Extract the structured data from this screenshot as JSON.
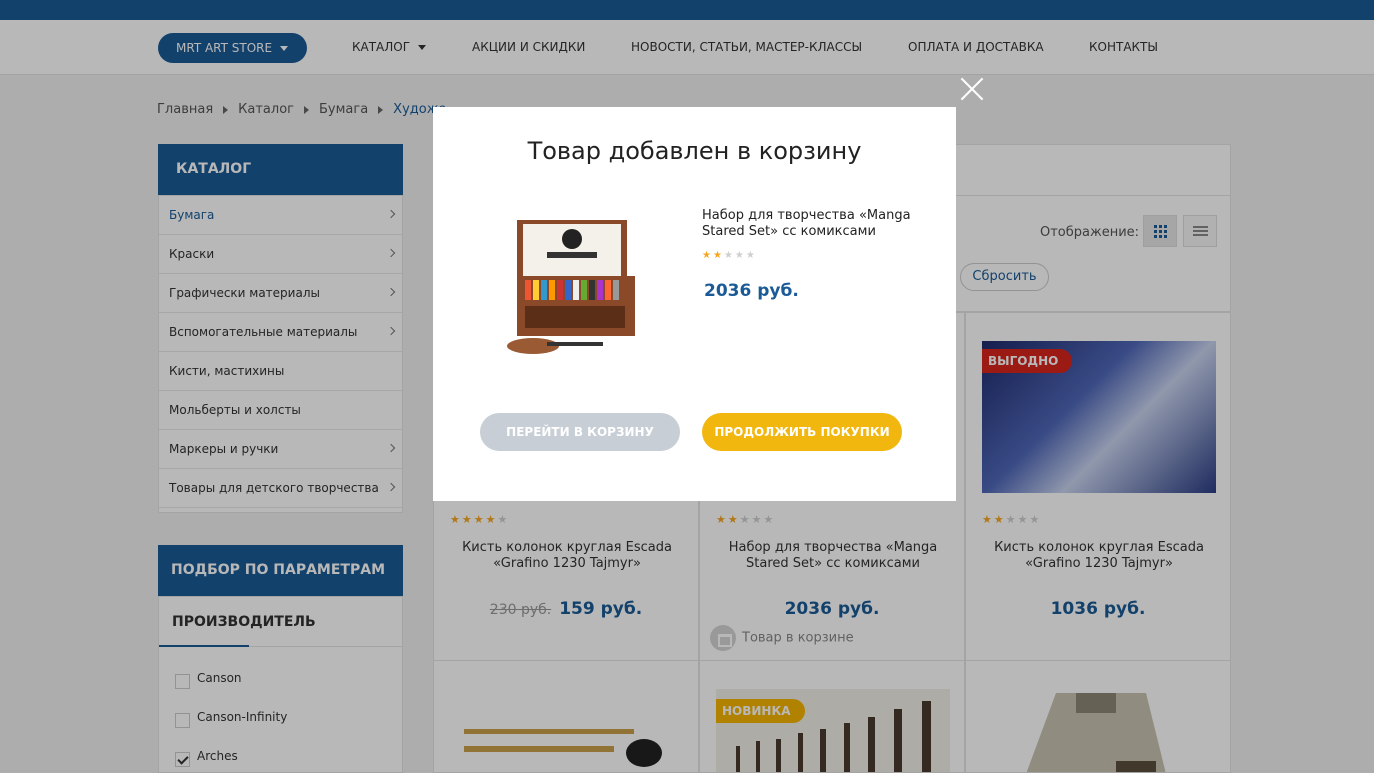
{
  "colors": {
    "brand": "#1a5a96",
    "accent_yellow": "#f2b70f",
    "badge_red": "#d9251c",
    "star": "#f5a623"
  },
  "nav": {
    "store": "MRT ART STORE",
    "items": [
      "КАТАЛОГ",
      "АКЦИИ И СКИДКИ",
      "НОВОСТИ, СТАТЬИ, МАСТЕР-КЛАССЫ",
      "ОПЛАТА И ДОСТАВКА",
      "КОНТАКТЫ"
    ]
  },
  "breadcrumb": [
    "Главная",
    "Каталог",
    "Бумага",
    "Художе"
  ],
  "sidebar": {
    "title": "КАТАЛОГ",
    "items": [
      {
        "label": "Бумага",
        "chevron": true
      },
      {
        "label": "Краски",
        "chevron": true
      },
      {
        "label": "Графически материалы",
        "chevron": true
      },
      {
        "label": "Вспомогательные материалы",
        "chevron": true
      },
      {
        "label": "Кисти, мастихины",
        "chevron": false
      },
      {
        "label": "Мольберты и холсты",
        "chevron": false
      },
      {
        "label": "Маркеры и ручки",
        "chevron": true
      },
      {
        "label": "Товары для детского творчества",
        "chevron": true
      }
    ]
  },
  "filter": {
    "title": "ПОДБОР ПО ПАРАМЕТРАМ",
    "section": "ПРОИЗВОДИТЕЛЬ",
    "options": [
      {
        "label": "Canson",
        "checked": false
      },
      {
        "label": "Canson-Infinity",
        "checked": false
      },
      {
        "label": "Arches",
        "checked": true
      }
    ]
  },
  "toolbar": {
    "display_label": "Отображение:",
    "reset": "Сбросить"
  },
  "products": [
    {
      "title": "Кисть колонок круглая Escada «Grafino 1230 Tajmyr»",
      "old_price": "230 руб.",
      "price": "159 руб.",
      "rating": 4,
      "badge": "",
      "in_cart": ""
    },
    {
      "title": "Набор для творчества «Manga Stared Set» сс комиксами",
      "old_price": "",
      "price": "2036 руб.",
      "rating": 2,
      "badge": "",
      "in_cart": "Товар в корзине"
    },
    {
      "title": "Кисть колонок круглая Escada «Grafino 1230 Tajmyr»",
      "old_price": "",
      "price": "1036 руб.",
      "rating": 2,
      "badge": "ВЫГОДНО",
      "in_cart": ""
    }
  ],
  "products_row2_badge": "НОВИНКА",
  "modal": {
    "title": "Товар добавлен в корзину",
    "product_name": "Набор для творчества «Manga Stared Set» сс комиксами",
    "rating": 2,
    "price": "2036 руб.",
    "btn_cart": "ПЕРЕЙТИ В КОРЗИНУ",
    "btn_continue": "ПРОДОЛЖИТЬ ПОКУПКИ"
  }
}
